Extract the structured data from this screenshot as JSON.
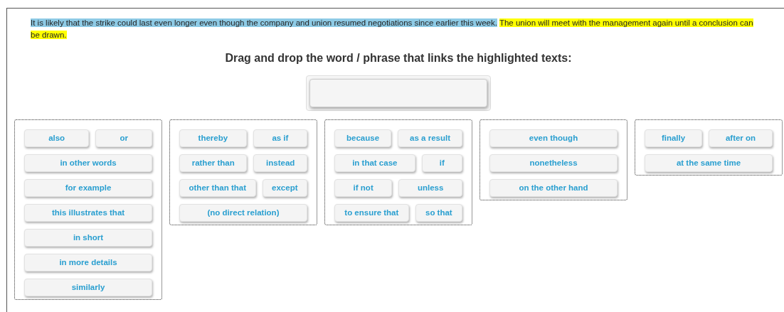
{
  "passage": [
    {
      "text": "It is likely that the strike could last even longer even though the company and union resumed negotiations since earlier this week.",
      "color": "#8ecbe6"
    },
    {
      "text": "The union will meet with the management again until a conclusion can be drawn.",
      "color": "#ffff00"
    }
  ],
  "instruction": "Drag and drop the word / phrase that links the highlighted texts:",
  "drop_zone": {
    "empty": true
  },
  "groups": [
    {
      "rows": [
        [
          "also",
          "or"
        ],
        [
          "in other words"
        ],
        [
          "for example"
        ],
        [
          "this illustrates that"
        ],
        [
          "in short"
        ],
        [
          "in more details"
        ],
        [
          "similarly"
        ]
      ]
    },
    {
      "rows": [
        [
          "thereby",
          "as if"
        ],
        [
          "rather than",
          "instead"
        ],
        [
          "other than that",
          "except"
        ],
        [
          "(no direct relation)"
        ]
      ]
    },
    {
      "rows": [
        [
          "because",
          "as a result"
        ],
        [
          "in that case",
          "if"
        ],
        [
          "if not",
          "unless"
        ],
        [
          "to ensure that",
          "so that"
        ]
      ]
    },
    {
      "rows": [
        [
          "even though"
        ],
        [
          "nonetheless"
        ],
        [
          "on the other hand"
        ]
      ]
    },
    {
      "rows": [
        [
          "finally",
          "after on"
        ],
        [
          "at the same time"
        ]
      ]
    }
  ]
}
